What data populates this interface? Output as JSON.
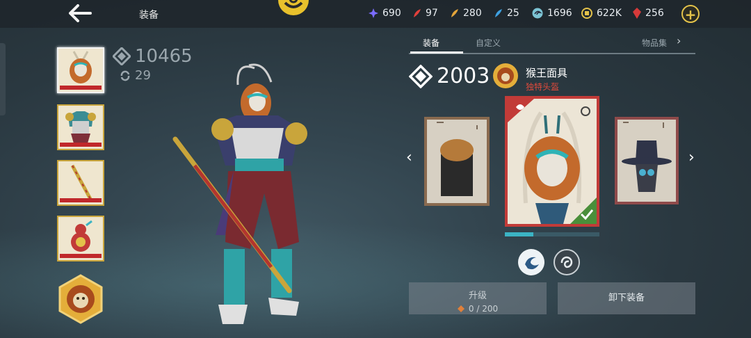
{
  "header": {
    "title": "装备"
  },
  "resources": [
    {
      "name": "purple-star",
      "value": "690",
      "color": "#7b6cff"
    },
    {
      "name": "red-feather",
      "value": "97",
      "color": "#e1403b"
    },
    {
      "name": "gold-feather",
      "value": "280",
      "color": "#e2a43a"
    },
    {
      "name": "blue-feather",
      "value": "25",
      "color": "#3ea0e0"
    },
    {
      "name": "spirit",
      "value": "1696",
      "color": "#7cc4d4"
    },
    {
      "name": "coin",
      "value": "622K",
      "color": "#e3c24a"
    },
    {
      "name": "ruby",
      "value": "256",
      "color": "#d63a3a"
    }
  ],
  "character": {
    "power": "10465",
    "level": "29"
  },
  "slots": [
    "helmet",
    "armor",
    "staff",
    "charm"
  ],
  "tabs": [
    {
      "label": "装备"
    },
    {
      "label": "自定义"
    },
    {
      "label": "物品集"
    }
  ],
  "item": {
    "power": "2003",
    "name": "猴王面具",
    "subtitle": "独特头盔",
    "equipped": true,
    "progress": 0.3
  },
  "upgrade": {
    "label": "升级",
    "progress": "0 / 200"
  },
  "unequip_label": "卸下装备",
  "colors": {
    "accent": "#e3c24a",
    "rare_red": "#c23b38",
    "teal": "#3bb4c4"
  }
}
